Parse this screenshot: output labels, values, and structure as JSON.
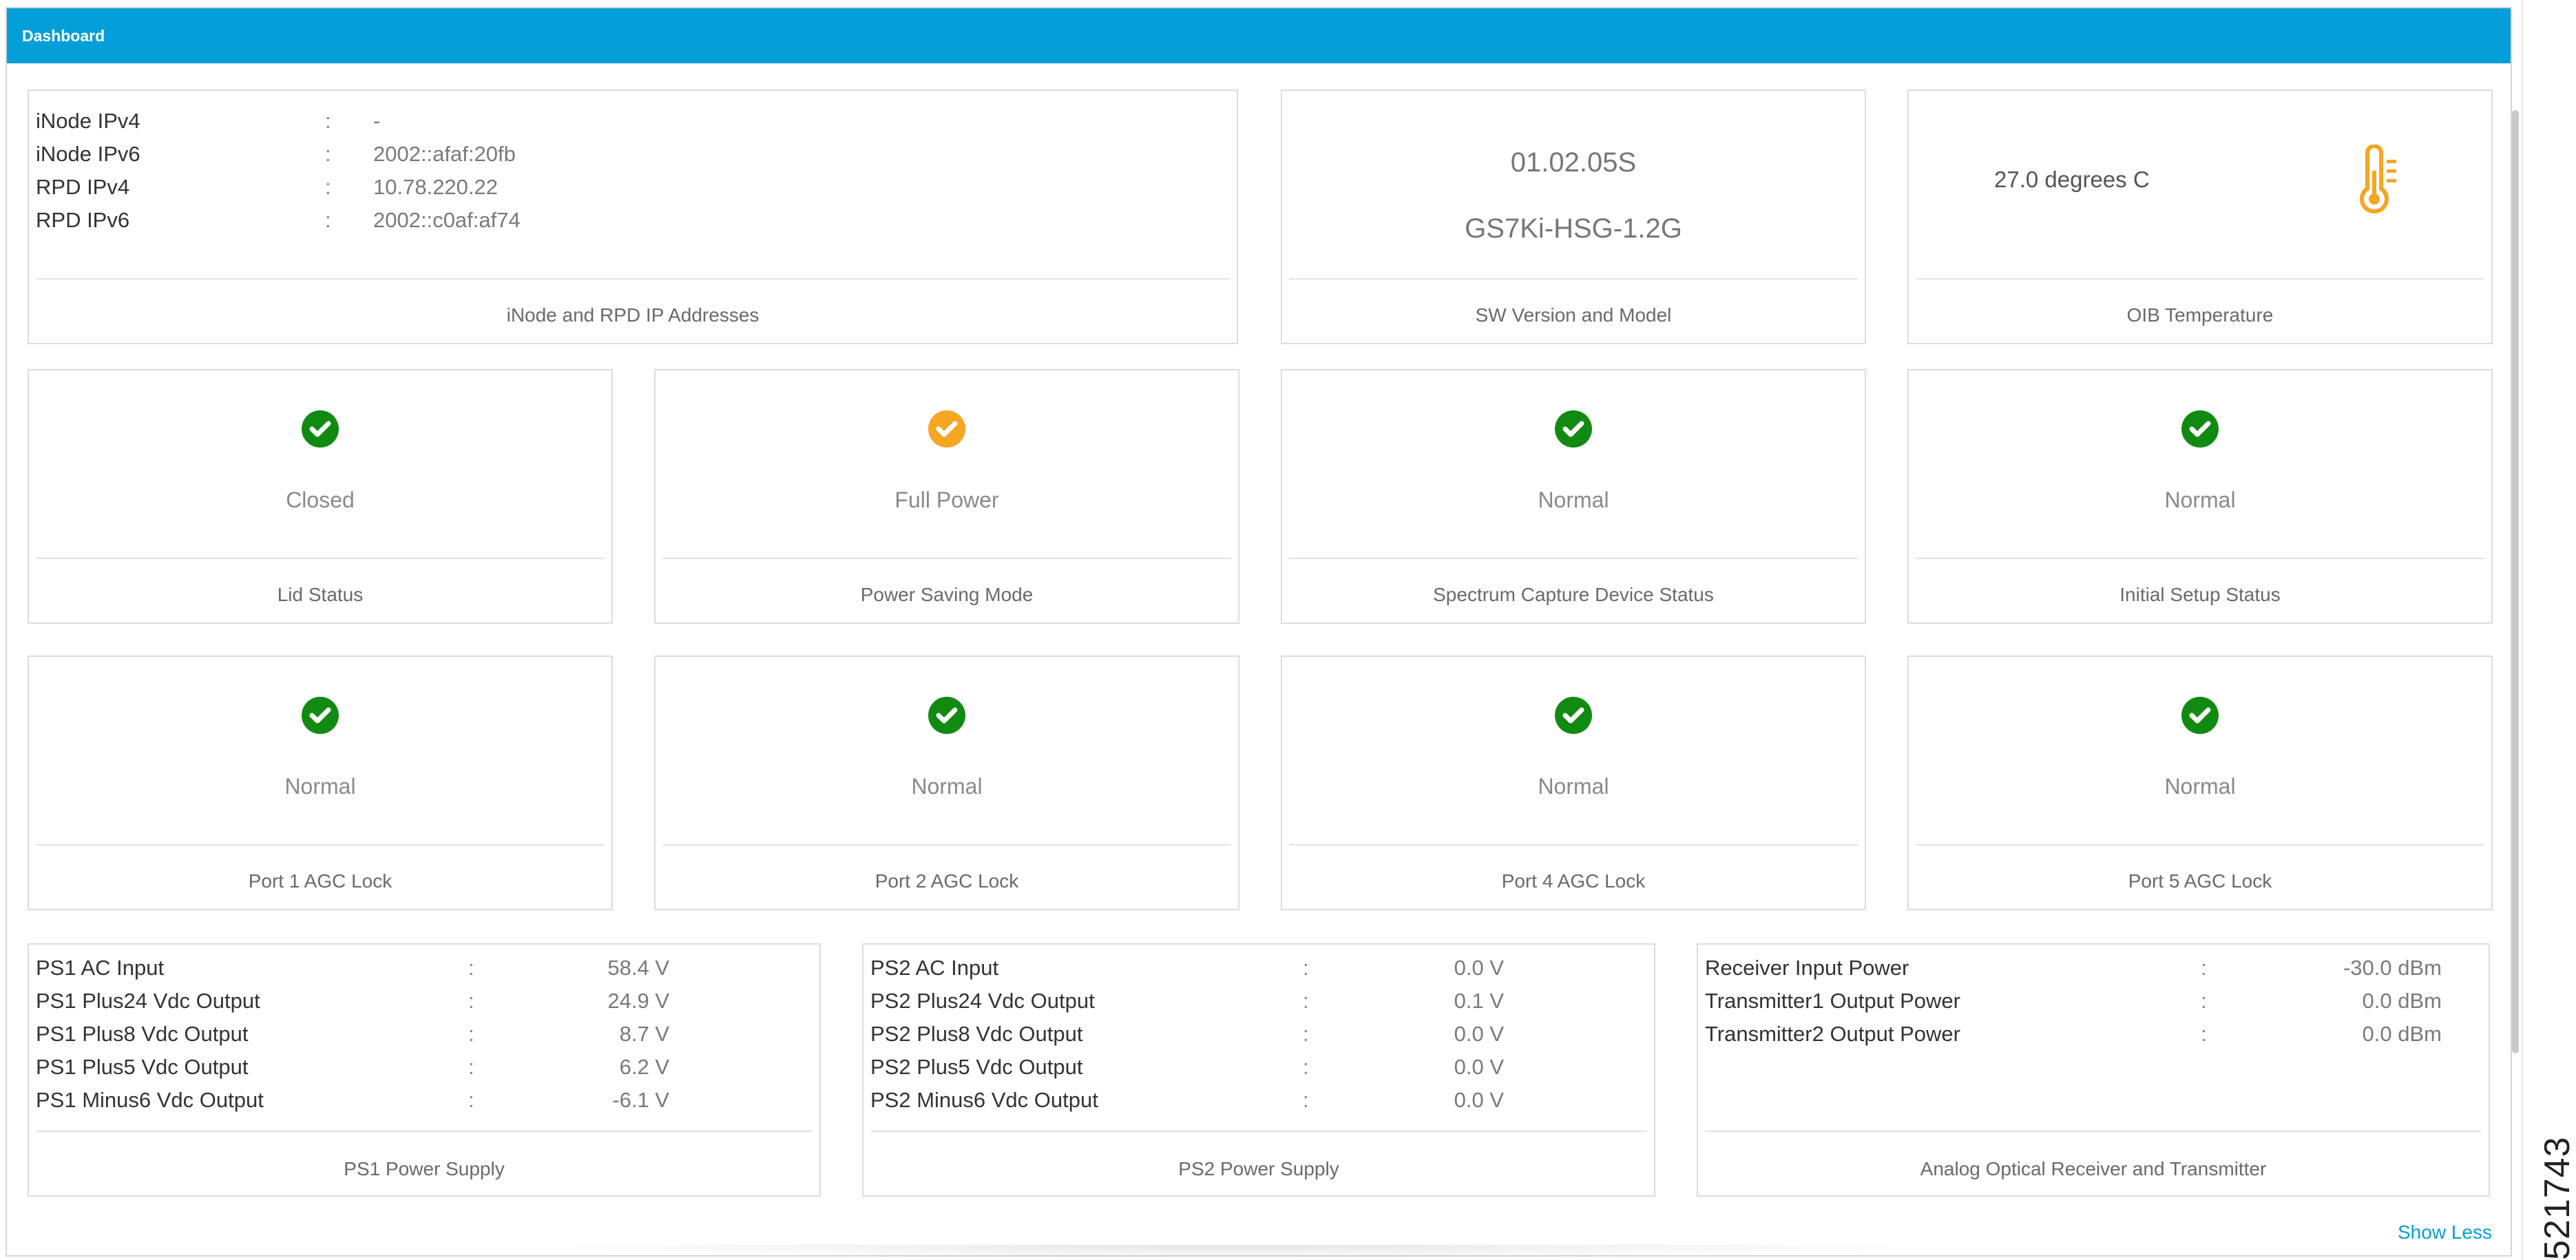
{
  "window": {
    "title": "Dashboard"
  },
  "ip_card": {
    "caption": "iNode and RPD IP Addresses",
    "rows": [
      {
        "key": "iNode IPv4",
        "sep": ":",
        "value": "-"
      },
      {
        "key": "iNode IPv6",
        "sep": ":",
        "value": "2002::afaf:20fb"
      },
      {
        "key": "RPD IPv4",
        "sep": ":",
        "value": "10.78.220.22"
      },
      {
        "key": "RPD IPv6",
        "sep": ":",
        "value": "2002::c0af:af74"
      }
    ]
  },
  "sw_card": {
    "caption": "SW Version and Model",
    "version": "01.02.05S",
    "model": "GS7Ki-HSG-1.2G"
  },
  "temp_card": {
    "caption": "OIB Temperature",
    "value": "27.0 degrees C",
    "icon": "thermometer-icon",
    "icon_color": "#f5a623"
  },
  "status_cards": [
    {
      "caption": "Lid Status",
      "status": "Closed",
      "color": "#118a11"
    },
    {
      "caption": "Power Saving Mode",
      "status": "Full Power",
      "color": "#f5a623"
    },
    {
      "caption": "Spectrum Capture Device Status",
      "status": "Normal",
      "color": "#118a11"
    },
    {
      "caption": "Initial Setup Status",
      "status": "Normal",
      "color": "#118a11"
    },
    {
      "caption": "Port 1 AGC Lock",
      "status": "Normal",
      "color": "#118a11"
    },
    {
      "caption": "Port 2 AGC Lock",
      "status": "Normal",
      "color": "#118a11"
    },
    {
      "caption": "Port 4 AGC Lock",
      "status": "Normal",
      "color": "#118a11"
    },
    {
      "caption": "Port 5 AGC Lock",
      "status": "Normal",
      "color": "#118a11"
    }
  ],
  "ps1_card": {
    "caption": "PS1 Power Supply",
    "rows": [
      {
        "key": "PS1 AC Input",
        "sep": ":",
        "value": "58.4 V"
      },
      {
        "key": "PS1 Plus24 Vdc Output",
        "sep": ":",
        "value": "24.9 V"
      },
      {
        "key": "PS1 Plus8 Vdc Output",
        "sep": ":",
        "value": "8.7 V"
      },
      {
        "key": "PS1 Plus5 Vdc Output",
        "sep": ":",
        "value": "6.2 V"
      },
      {
        "key": "PS1 Minus6 Vdc Output",
        "sep": ":",
        "value": "-6.1 V"
      }
    ]
  },
  "ps2_card": {
    "caption": "PS2 Power Supply",
    "rows": [
      {
        "key": "PS2 AC Input",
        "sep": ":",
        "value": "0.0 V"
      },
      {
        "key": "PS2 Plus24 Vdc Output",
        "sep": ":",
        "value": "0.1 V"
      },
      {
        "key": "PS2 Plus8 Vdc Output",
        "sep": ":",
        "value": "0.0 V"
      },
      {
        "key": "PS2 Plus5 Vdc Output",
        "sep": ":",
        "value": "0.0 V"
      },
      {
        "key": "PS2 Minus6 Vdc Output",
        "sep": ":",
        "value": "0.0 V"
      }
    ]
  },
  "optical_card": {
    "caption": "Analog Optical Receiver and Transmitter",
    "rows": [
      {
        "key": "Receiver Input Power",
        "sep": ":",
        "value": "-30.0 dBm"
      },
      {
        "key": "Transmitter1 Output Power",
        "sep": ":",
        "value": "0.0 dBm"
      },
      {
        "key": "Transmitter2 Output Power",
        "sep": ":",
        "value": "0.0 dBm"
      }
    ]
  },
  "footer": {
    "show_less": "Show Less"
  },
  "figure_number": "521743"
}
